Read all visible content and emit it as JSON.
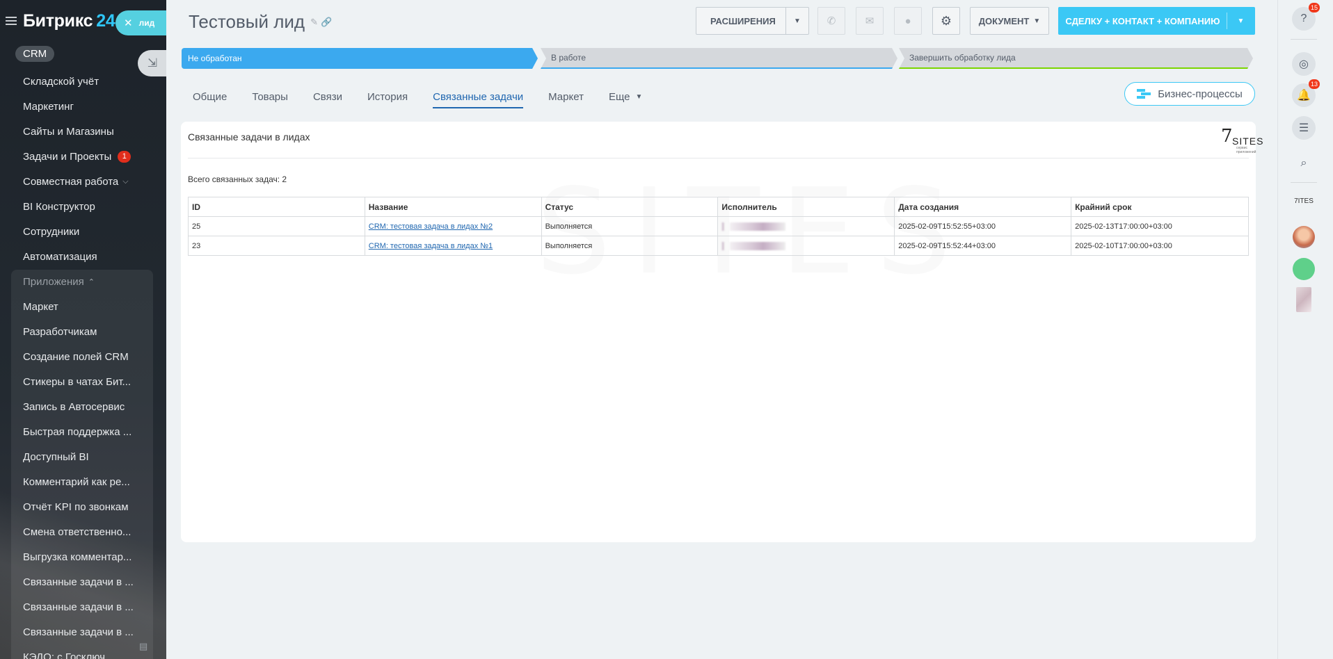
{
  "app": {
    "logo_text": "Битрикс",
    "logo_num": "24",
    "lead_tab_label": "лид",
    "crm_chip": "CRM"
  },
  "sidebar": {
    "items": [
      {
        "label": "Складской учёт"
      },
      {
        "label": "Маркетинг"
      },
      {
        "label": "Сайты и Магазины"
      },
      {
        "label": "Задачи и Проекты",
        "badge": "1"
      },
      {
        "label": "Совместная работа"
      },
      {
        "label": "BI Конструктор"
      },
      {
        "label": "Сотрудники"
      },
      {
        "label": "Автоматизация"
      }
    ],
    "apps_header": "Приложения",
    "apps": [
      {
        "label": "Маркет"
      },
      {
        "label": "Разработчикам"
      },
      {
        "label": "Создание полей CRM"
      },
      {
        "label": "Стикеры в чатах Бит..."
      },
      {
        "label": "Запись в Автосервис"
      },
      {
        "label": "Быстрая поддержка ..."
      },
      {
        "label": "Доступный BI"
      },
      {
        "label": "Комментарий как ре..."
      },
      {
        "label": "Отчёт KPI по звонкам"
      },
      {
        "label": "Смена ответственно..."
      },
      {
        "label": "Выгрузка комментар..."
      },
      {
        "label": "Связанные задачи в ..."
      },
      {
        "label": "Связанные задачи в ..."
      },
      {
        "label": "Связанные задачи в ..."
      },
      {
        "label": "КЭДО: с Госключ"
      }
    ]
  },
  "header": {
    "title": "Тестовый лид",
    "extensions_label": "РАСШИРЕНИЯ",
    "document_label": "ДОКУМЕНТ",
    "primary_label": "СДЕЛКУ + КОНТАКТ + КОМПАНИЮ"
  },
  "stages": [
    {
      "label": "Не обработан"
    },
    {
      "label": "В работе"
    },
    {
      "label": "Завершить обработку лида"
    }
  ],
  "tabs": [
    {
      "label": "Общие"
    },
    {
      "label": "Товары"
    },
    {
      "label": "Связи"
    },
    {
      "label": "История"
    },
    {
      "label": "Связанные задачи"
    },
    {
      "label": "Маркет"
    },
    {
      "label": "Еще"
    }
  ],
  "business_processes_label": "Бизнес-процессы",
  "card": {
    "title": "Связанные задачи в лидах",
    "brand_seven": "7",
    "brand_sites": "SITES",
    "brand_small": "сервис приложений",
    "watermark": "SITES",
    "total_label": "Всего связанных задач: 2",
    "columns": [
      "ID",
      "Название",
      "Статус",
      "Исполнитель",
      "Дата создания",
      "Крайний срок"
    ],
    "rows": [
      {
        "id": "25",
        "name": "CRM: тестовая задача в лидах №2",
        "status": "Выполняется",
        "created": "2025-02-09T15:52:55+03:00",
        "deadline": "2025-02-13T17:00:00+03:00"
      },
      {
        "id": "23",
        "name": "CRM: тестовая задача в лидах №1",
        "status": "Выполняется",
        "created": "2025-02-09T15:52:44+03:00",
        "deadline": "2025-02-10T17:00:00+03:00"
      }
    ]
  },
  "rightbar": {
    "help_badge": "15",
    "notifications_badge": "13"
  },
  "colors": {
    "accent": "#3bc8f5",
    "stage_active": "#3ba9ef",
    "tab_active": "#2067b0",
    "badge_red": "#e02e1c"
  }
}
